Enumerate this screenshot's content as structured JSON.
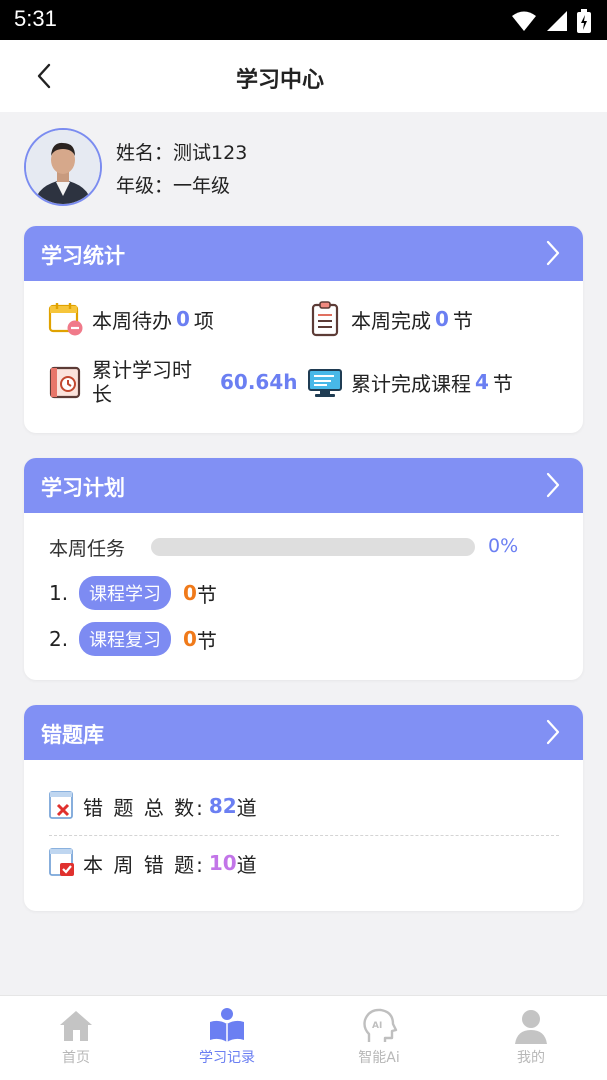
{
  "status_bar": {
    "time": "5:31"
  },
  "nav": {
    "title": "学习中心"
  },
  "profile": {
    "name_label": "姓名：",
    "name_value": "测试123",
    "grade_label": "年级：",
    "grade_value": "一年级"
  },
  "study_stats": {
    "title": "学习统计",
    "week_todo": {
      "label": "本周待办",
      "value": "0",
      "unit": "项"
    },
    "week_done": {
      "label": "本周完成",
      "value": "0",
      "unit": "节"
    },
    "total_time": {
      "label": "累计学习时长",
      "value": "60.64h"
    },
    "total_courses": {
      "label": "累计完成课程",
      "value": "4",
      "unit": "节"
    }
  },
  "study_plan": {
    "title": "学习计划",
    "week_task_label": "本周任务",
    "progress_percent": 0,
    "progress_text": "0%",
    "items": [
      {
        "index": "1.",
        "name": "课程学习",
        "count": "0",
        "unit": "节"
      },
      {
        "index": "2.",
        "name": "课程复习",
        "count": "0",
        "unit": "节"
      }
    ]
  },
  "wrong_bank": {
    "title": "错题库",
    "total_label": "错 题 总 数: ",
    "total_value": "82",
    "total_unit": "道",
    "week_label": "本 周 错 题: ",
    "week_value": "10",
    "week_unit": "道"
  },
  "tabs": [
    {
      "label": "首页",
      "icon": "home-icon",
      "active": false
    },
    {
      "label": "学习记录",
      "icon": "book-person-icon",
      "active": true
    },
    {
      "label": "智能Ai",
      "icon": "ai-head-icon",
      "active": false
    },
    {
      "label": "我的",
      "icon": "person-icon",
      "active": false
    }
  ],
  "colors": {
    "accent": "#8190f4",
    "accent_text": "#6b7ff2",
    "orange": "#f07a1a",
    "purple": "#c275e8"
  }
}
